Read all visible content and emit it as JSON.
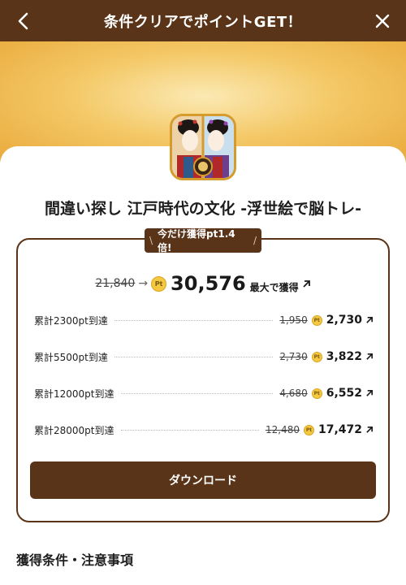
{
  "header": {
    "title": "条件クリアでポイントGET！",
    "back_icon": "chevron-left-icon",
    "close_icon": "close-icon"
  },
  "app": {
    "name": "間違い探し 江戸時代の文化 -浮世絵で脳トレ-",
    "icon": "ukiyoe-app-icon"
  },
  "promo": {
    "badge_left": "\\",
    "badge_text": "今だけ獲得pt1.4倍!",
    "badge_right": "/"
  },
  "main_reward": {
    "old_value": "21,840",
    "arrow": "→",
    "coin_label": "Pt",
    "new_value": "30,576",
    "suffix": "最大で獲得"
  },
  "milestones": [
    {
      "label": "累計2300pt到達",
      "old": "1,950",
      "new": "2,730"
    },
    {
      "label": "累計5500pt到達",
      "old": "2,730",
      "new": "3,822"
    },
    {
      "label": "累計12000pt到達",
      "old": "4,680",
      "new": "6,552"
    },
    {
      "label": "累計28000pt到達",
      "old": "12,480",
      "new": "17,472"
    }
  ],
  "download_button": "ダウンロード",
  "conditions_title": "獲得条件・注意事項",
  "colors": {
    "brand_brown": "#5a3418",
    "gold_banner": "#f4c968",
    "coin": "#f5c842"
  }
}
